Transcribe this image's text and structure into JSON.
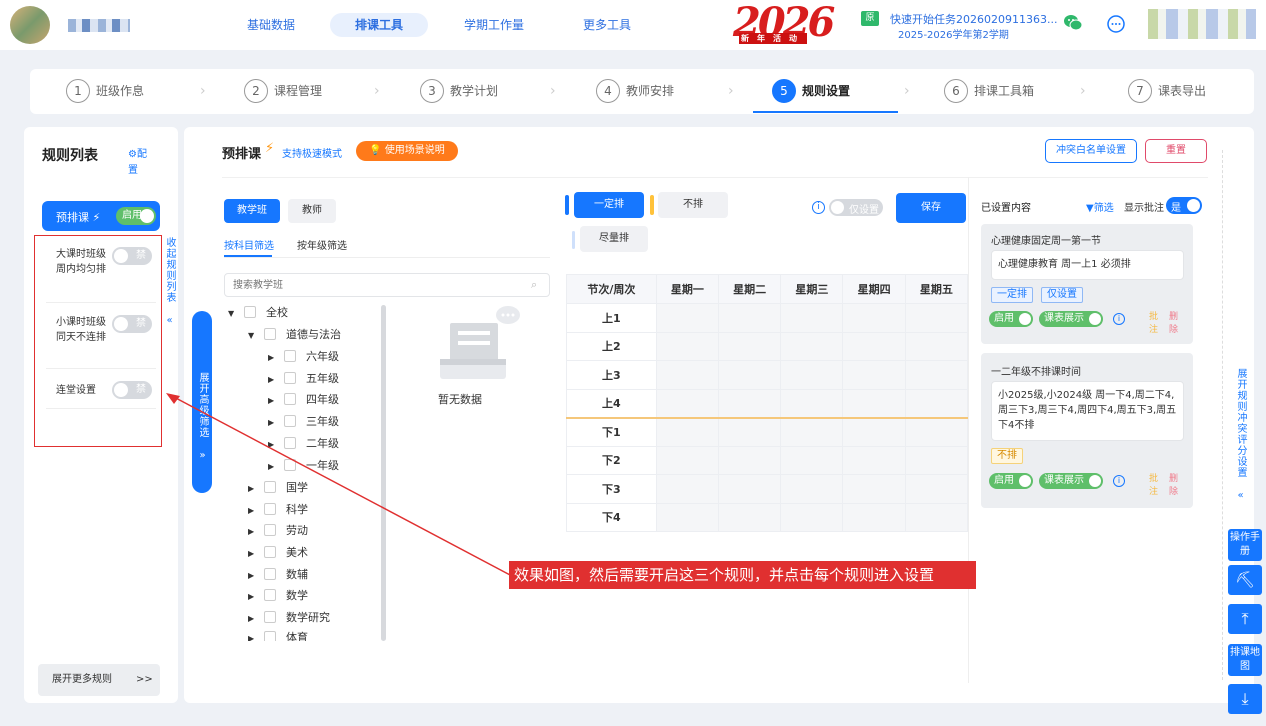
{
  "header": {
    "nav": [
      "基础数据",
      "排课工具",
      "学期工作量",
      "更多工具"
    ],
    "logo_year": "2026",
    "logo_sub": "新年活动",
    "task_badge": "原",
    "task_title": "快速开始任务2026020911363...",
    "task_term": "2025-2026学年第2学期"
  },
  "steps": [
    {
      "num": "1",
      "label": "班级作息"
    },
    {
      "num": "2",
      "label": "课程管理"
    },
    {
      "num": "3",
      "label": "教学计划"
    },
    {
      "num": "4",
      "label": "教师安排"
    },
    {
      "num": "5",
      "label": "规则设置"
    },
    {
      "num": "6",
      "label": "排课工具箱"
    },
    {
      "num": "7",
      "label": "课表导出"
    }
  ],
  "left_panel": {
    "title": "规则列表",
    "config": "⚙配置",
    "preset": {
      "label": "预排课 ⚡",
      "state": "启用"
    },
    "collapse": "收起规则列表 «",
    "rules": [
      {
        "label": "大课时班级周内均匀排",
        "state": "禁"
      },
      {
        "label": "小课时班级同天不连排",
        "state": "禁"
      },
      {
        "label": "连堂设置",
        "state": "禁"
      }
    ],
    "more": "展开更多规则",
    "more_arrow": ">>"
  },
  "main": {
    "title": "预排课",
    "fast_mode": "支持极速模式",
    "usage_btn": "使用场景说明",
    "whitelist_btn": "冲突白名单设置",
    "reset_btn": "重置",
    "tabs": [
      "教学班",
      "教师"
    ],
    "filter_tabs": [
      "按科目筛选",
      "按年级筛选"
    ],
    "search_placeholder": "搜索教学班",
    "expand_filter": "展开高级筛选 »",
    "tree": [
      "全校",
      "道德与法治",
      "六年级",
      "五年级",
      "四年级",
      "三年级",
      "二年级",
      "一年级",
      "国学",
      "科学",
      "劳动",
      "美术",
      "数辅",
      "数学",
      "数学研究",
      "体育"
    ],
    "no_data": "暂无数据",
    "modes": [
      "一定排",
      "不排",
      "尽量排"
    ],
    "only_set": "仅设置",
    "save": "保存",
    "grid_headers": [
      "节次/周次",
      "星期一",
      "星期二",
      "星期三",
      "星期四",
      "星期五"
    ],
    "periods": [
      "上1",
      "上2",
      "上3",
      "上4",
      "下1",
      "下2",
      "下3",
      "下4"
    ]
  },
  "right_panel": {
    "title": "已设置内容",
    "filter": "筛选",
    "show_note": "显示批注",
    "show_note_state": "是",
    "cards": [
      {
        "title": "心理健康固定周一第一节",
        "content": "心理健康教育 周一上1 必须排",
        "tags": [
          "一定排",
          "仅设置"
        ],
        "enable": "启用",
        "show": "课表展示",
        "note": "批注",
        "del": "删除"
      },
      {
        "title": "一二年级不排课时间",
        "content": "小2025级,小2024级 周一下4,周二下4,周三下3,周三下4,周四下4,周五下3,周五下4不排",
        "tags": [
          "不排"
        ],
        "enable": "启用",
        "show": "课表展示",
        "note": "批注",
        "del": "删除"
      }
    ],
    "rule_conflict": "展开规则冲突评分设置 «"
  },
  "rail": {
    "manual": "操作手册",
    "map": "排课地图"
  },
  "annotation": "效果如图，然后需要开启这三个规则，并点击每个规则进入设置",
  "colors": {
    "primary": "#1677ff",
    "orange": "#ff7a1a",
    "red": "#e03030",
    "green": "#5fbf6a"
  }
}
